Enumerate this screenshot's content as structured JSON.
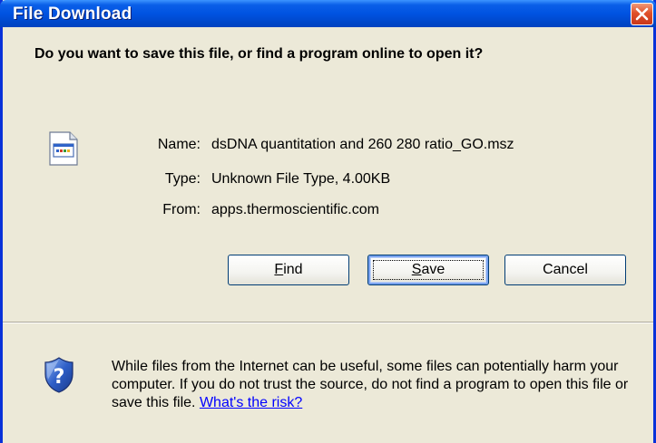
{
  "window": {
    "title": "File Download"
  },
  "dialog": {
    "question": "Do you want to save this file, or find a program online to open it?",
    "file_icon": "generic-file-icon",
    "fields": [
      {
        "label": "Name:",
        "value": "dsDNA quantitation and 260 280 ratio_GO.msz"
      },
      {
        "label": "Type:",
        "value": "Unknown File Type, 4.00KB"
      },
      {
        "label": "From:",
        "value": "apps.thermoscientific.com"
      }
    ],
    "buttons": {
      "find": {
        "accel": "F",
        "rest": "ind"
      },
      "save": {
        "accel": "S",
        "rest": "ave"
      },
      "cancel": "Cancel"
    }
  },
  "warning": {
    "icon": "security-shield-icon",
    "text": "While files from the Internet can be useful, some files can potentially harm your computer. If you do not trust the source, do not find a program to open this file or save this file.",
    "link": "What's the risk?"
  },
  "colors": {
    "titlebar": "#0053E1",
    "dialog_bg": "#ECE9D8",
    "close_button": "#E0502A",
    "link": "#0000FF"
  }
}
